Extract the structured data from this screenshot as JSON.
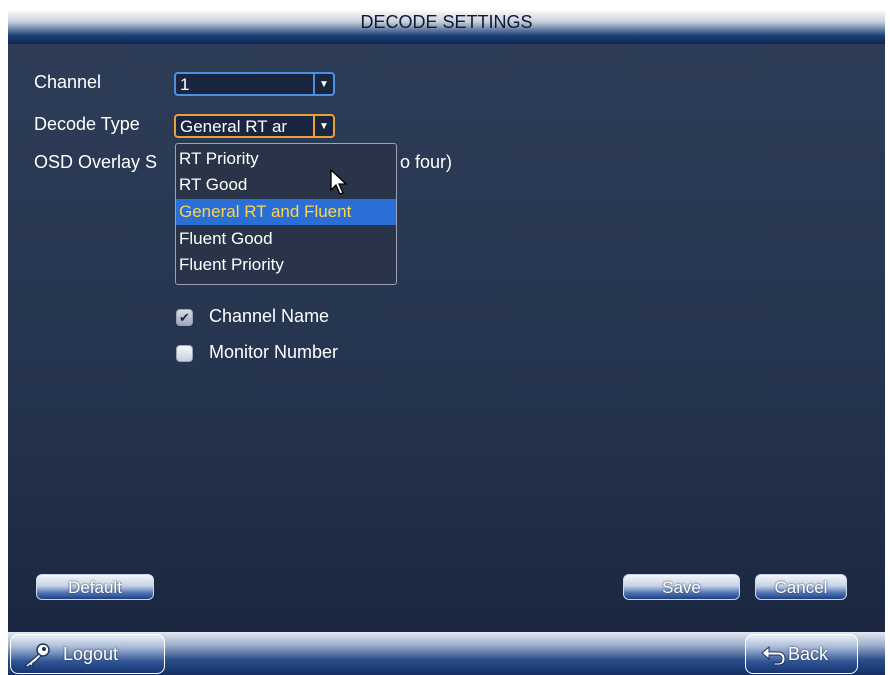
{
  "window": {
    "title": "DECODE SETTINGS"
  },
  "form": {
    "channel_label": "Channel",
    "channel_value": "1",
    "decode_type_label": "Decode Type",
    "decode_type_value": "General RT ar",
    "osd_label_left": "OSD Overlay S",
    "osd_label_right": "o four)"
  },
  "decode_type_options": [
    {
      "label": "RT Priority",
      "selected": false
    },
    {
      "label": "RT Good",
      "selected": false
    },
    {
      "label": "General RT and Fluent",
      "selected": true
    },
    {
      "label": "Fluent Good",
      "selected": false
    },
    {
      "label": "Fluent Priority",
      "selected": false
    }
  ],
  "checkboxes": [
    {
      "label": "Channel Name",
      "checked": true
    },
    {
      "label": "Monitor Number",
      "checked": false
    }
  ],
  "buttons": {
    "default": "Default",
    "save": "Save",
    "cancel": "Cancel"
  },
  "bottom_bar": {
    "logout": "Logout",
    "back": "Back"
  },
  "colors": {
    "accent_border": "#4d8fe0",
    "focus_border": "#e8a13a",
    "selected_option_bg": "#2a6fd6",
    "selected_option_text": "#ffd34a",
    "content_bg": "#2e3d57"
  },
  "icons": {
    "dropdown_arrow": "chevron-down-icon",
    "logout": "key-icon",
    "back": "back-arrow-icon",
    "cursor": "mouse-pointer-icon"
  }
}
